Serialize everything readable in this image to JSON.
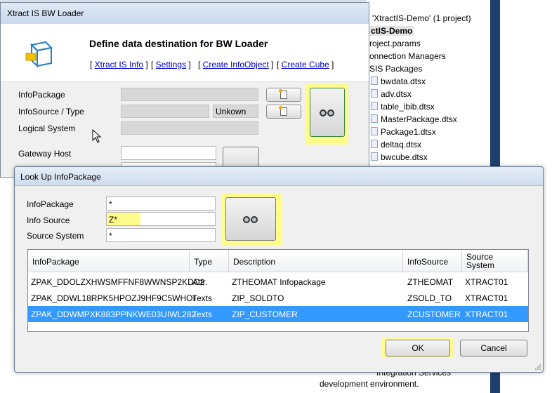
{
  "solution_explorer": {
    "solution_title": "'XtractIS-Demo' (1 project)",
    "project_name": "ctIS-Demo",
    "items": [
      "roject.params",
      "onnection Managers",
      "SIS Packages"
    ],
    "files": [
      "bwdata.dtsx",
      "adv.dtsx",
      "table_ibib.dtsx",
      "MasterPackage.dtsx",
      "Package1.dtsx",
      "deltaq.dtsx",
      "bwcube.dtsx"
    ],
    "bottom_items": [
      "Integration Services",
      "development environment."
    ]
  },
  "main_dialog": {
    "title": "Xtract IS BW Loader",
    "heading": "Define data destination for BW Loader",
    "links": [
      "Xtract IS Info",
      "Settings",
      "Create InfoObject",
      "Create Cube"
    ],
    "labels": {
      "infopackage": "InfoPackage",
      "infosource_type": "InfoSource / Type",
      "logical_system": "Logical System",
      "gateway_host": "Gateway Host"
    },
    "type_value": "Unkown"
  },
  "lookup_dialog": {
    "title": "Look Up InfoPackage",
    "fields": {
      "infopackage_label": "InfoPackage",
      "infopackage_value": "*",
      "infosource_label": "Info Source",
      "infosource_value": "Z*",
      "source_system_label": "Source System",
      "source_system_value": "*"
    },
    "columns": [
      "InfoPackage",
      "Type",
      "Description",
      "InfoSource",
      "Source System"
    ],
    "rows": [
      {
        "infopackage": "ZPAK_DDOLZXHWSMFFNF8WWNSP2KDC2",
        "type": "Attr.",
        "description": "ZTHEOMAT Infopackage",
        "infosource": "ZTHEOMAT",
        "source_system": "XTRACT01"
      },
      {
        "infopackage": "ZPAK_DDWL18RPK5HPOZJ9HF9C5WHOI",
        "type": "Texts",
        "description": "ZIP_SOLDTO",
        "infosource": "ZSOLD_TO",
        "source_system": "XTRACT01"
      },
      {
        "infopackage": "ZPAK_DDWMPXK883PPNKWE03UIWL282",
        "type": "Texts",
        "description": "ZIP_CUSTOMER",
        "infosource": "ZCUSTOMER",
        "source_system": "XTRACT01"
      }
    ],
    "selected_row_index": 2,
    "ok_label": "OK",
    "cancel_label": "Cancel"
  },
  "colors": {
    "highlight": "#fdfb8a",
    "selection": "#3399ff",
    "link": "#0000cc"
  }
}
